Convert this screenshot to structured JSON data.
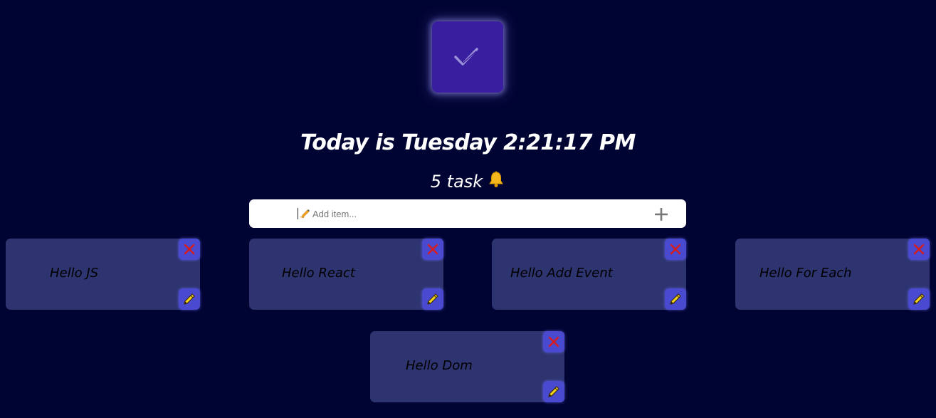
{
  "app": {
    "logo_icon": "double-check-icon"
  },
  "header": {
    "headline": "Today is Tuesday 2:21:17 PM",
    "task_count": "5 task",
    "bell_icon": "bell-icon"
  },
  "add_item": {
    "placeholder": "Add item...",
    "pen_emoji": "✍",
    "add_icon": "plus-icon"
  },
  "tasks": [
    {
      "label": "Hello JS"
    },
    {
      "label": "Hello React"
    },
    {
      "label": "Hello Add Event"
    },
    {
      "label": "Hello For Each"
    },
    {
      "label": "Hello Dom"
    }
  ],
  "colors": {
    "background": "#000433",
    "logo": "#3a1ea0",
    "card": "#2e3470",
    "button": "#4a4ad0",
    "delete_x": "#d81b1b",
    "edit_pencil": "#f2d21b"
  }
}
